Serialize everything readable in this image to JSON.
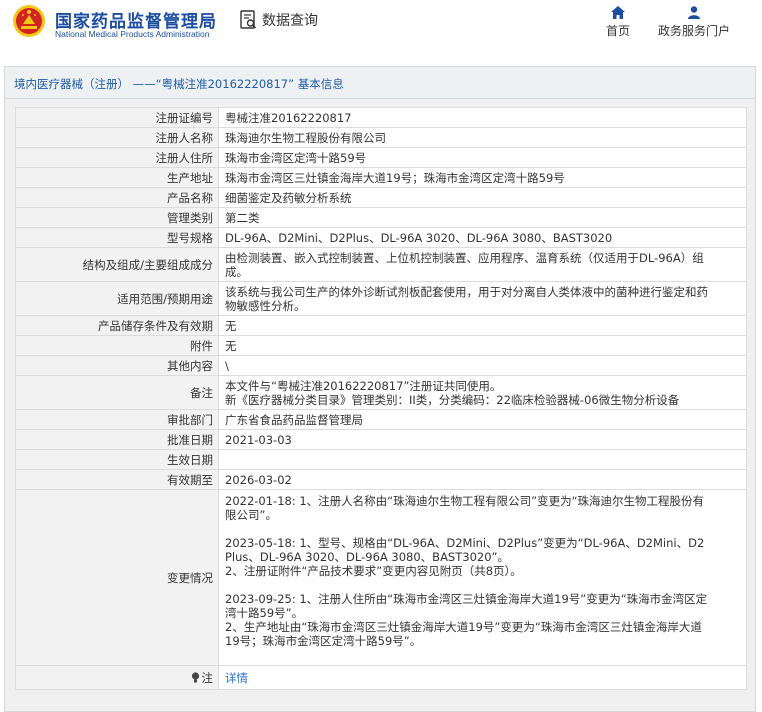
{
  "header": {
    "site_name_cn": "国家药品监督管理局",
    "site_name_en": "National Medical Products Administration",
    "query_label": "数据查询",
    "nav_home": "首页",
    "nav_portal": "政务服务门户"
  },
  "breadcrumb": {
    "category": "境内医疗器械（注册）",
    "separator": "——",
    "record": "“粤械注准20162220817”",
    "suffix": "基本信息"
  },
  "rows": [
    {
      "label": "注册证编号",
      "value": [
        "粤械注准20162220817"
      ]
    },
    {
      "label": "注册人名称",
      "value": [
        "珠海迪尔生物工程股份有限公司"
      ]
    },
    {
      "label": "注册人住所",
      "value": [
        "珠海市金湾区定湾十路59号"
      ]
    },
    {
      "label": "生产地址",
      "value": [
        "珠海市金湾区三灶镇金海岸大道19号；珠海市金湾区定湾十路59号"
      ]
    },
    {
      "label": "产品名称",
      "value": [
        "细菌鉴定及药敏分析系统"
      ]
    },
    {
      "label": "管理类别",
      "value": [
        "第二类"
      ]
    },
    {
      "label": "型号规格",
      "value": [
        "DL-96A、D2Mini、D2Plus、DL-96A 3020、DL-96A 3080、BAST3020"
      ]
    },
    {
      "label": "结构及组成/主要组成成分",
      "value": [
        "由检测装置、嵌入式控制装置、上位机控制装置、应用程序、温育系统（仅适用于DL-96A）组",
        "成。"
      ]
    },
    {
      "label": "适用范围/预期用途",
      "value": [
        "该系统与我公司生产的体外诊断试剂板配套使用，用于对分离自人类体液中的菌种进行鉴定和药",
        "物敏感性分析。"
      ]
    },
    {
      "label": "产品储存条件及有效期",
      "value": [
        "无"
      ]
    },
    {
      "label": "附件",
      "value": [
        "无"
      ]
    },
    {
      "label": "其他内容",
      "value": [
        "\\"
      ]
    },
    {
      "label": "备注",
      "value": [
        "本文件与“粤械注准20162220817”注册证共同使用。",
        "新《医疗器械分类目录》管理类别：II类，分类编码：22临床检验器械-06微生物分析设备"
      ]
    },
    {
      "label": "审批部门",
      "value": [
        "广东省食品药品监督管理局"
      ]
    },
    {
      "label": "批准日期",
      "value": [
        "2021-03-03"
      ]
    },
    {
      "label": "生效日期",
      "value": [
        ""
      ]
    },
    {
      "label": "有效期至",
      "value": [
        "2026-03-02"
      ]
    }
  ],
  "changes": {
    "label": "变更情况",
    "entries": [
      [
        "2022-01-18: 1、注册人名称由“珠海迪尔生物工程有限公司”变更为“珠海迪尔生物工程股份有",
        "限公司”。"
      ],
      [
        "2023-05-18: 1、型号、规格由“DL-96A、D2Mini、D2Plus”变更为“DL-96A、D2Mini、D2",
        "Plus、DL-96A 3020、DL-96A 3080、BAST3020”。",
        "2、注册证附件“产品技术要求”变更内容见附页（共8页）。"
      ],
      [
        "2023-09-25: 1、注册人住所由“珠海市金湾区三灶镇金海岸大道19号”变更为“珠海市金湾区定",
        "湾十路59号”。",
        "2、生产地址由“珠海市金湾区三灶镇金海岸大道19号”变更为“珠海市金湾区三灶镇金海岸大道",
        "19号；珠海市金湾区定湾十路59号”。"
      ]
    ]
  },
  "note": {
    "label": "注",
    "link": "详情"
  },
  "colors": {
    "brand_blue": "#1d4ea1",
    "link_blue": "#2a6fc4",
    "emblem_red": "#d3251f",
    "emblem_gold": "#f5c518"
  },
  "icons": {
    "emblem": "national-emblem-icon",
    "query": "data-query-icon",
    "home": "home-icon",
    "portal": "user-icon",
    "note": "bulb-icon"
  }
}
